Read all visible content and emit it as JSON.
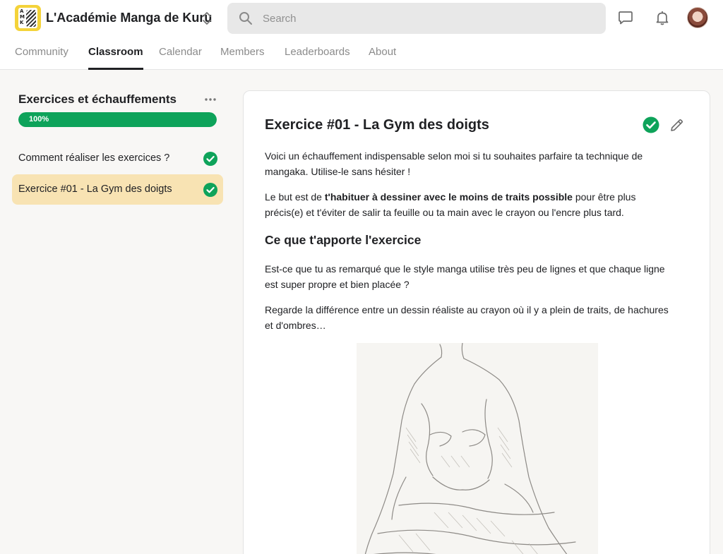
{
  "app": {
    "group_name": "L'Académie Manga de Kuru",
    "logo_letters": "A\nM\nK"
  },
  "search": {
    "placeholder": "Search",
    "value": ""
  },
  "header_icons": [
    "chat-icon",
    "bell-icon",
    "avatar"
  ],
  "tabs": [
    {
      "label": "Community",
      "active": false
    },
    {
      "label": "Classroom",
      "active": true
    },
    {
      "label": "Calendar",
      "active": false
    },
    {
      "label": "Members",
      "active": false
    },
    {
      "label": "Leaderboards",
      "active": false
    },
    {
      "label": "About",
      "active": false
    }
  ],
  "course": {
    "title": "Exercices et échauffements",
    "progress_label": "100%",
    "progress": 1.0,
    "lessons": [
      {
        "label": "Comment réaliser les exercices ?",
        "completed": true,
        "active": false
      },
      {
        "label": "Exercice #01 - La Gym des doigts",
        "completed": true,
        "active": true
      }
    ]
  },
  "lesson": {
    "title": "Exercice #01 - La Gym des doigts",
    "completed": true,
    "p1": "Voici un échauffement indispensable selon moi si tu souhaites parfaire ta technique de mangaka. Utilise-le sans hésiter !",
    "p2_before": "Le but est de ",
    "p2_bold": "t'habituer à dessiner avec le moins de traits possible",
    "p2_after": " pour être plus précis(e) et t'éviter de salir ta feuille ou ta main avec le crayon ou l'encre plus tard.",
    "subheading": "Ce que t'apporte l'exercice",
    "p3": "Est-ce que tu as remarqué que le style manga utilise très peu de lignes et que chaque ligne est super propre et bien placée ?",
    "p4": "Regarde la différence entre un dessin réaliste au crayon où il y a plein de traits, de hachures et d'ombres…"
  },
  "colors": {
    "accent_green": "#0ea35a",
    "active_lesson_bg": "#f8e3b3",
    "logo_yellow": "#f4d33a"
  }
}
